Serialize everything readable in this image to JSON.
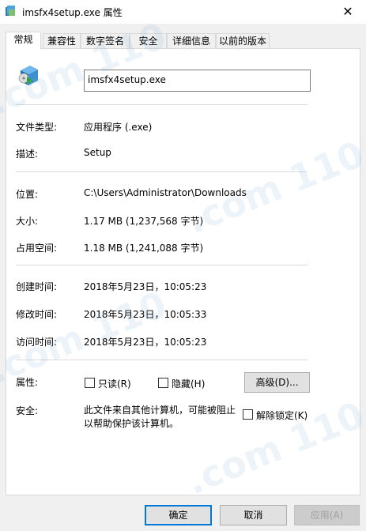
{
  "window": {
    "title": "imsfx4setup.exe 属性",
    "close_glyph": "✕",
    "title_icon": "executable-icon"
  },
  "tabs": [
    {
      "label": "常规",
      "active": true
    },
    {
      "label": "兼容性",
      "active": false
    },
    {
      "label": "数字签名",
      "active": false
    },
    {
      "label": "安全",
      "active": false
    },
    {
      "label": "详细信息",
      "active": false
    },
    {
      "label": "以前的版本",
      "active": false
    }
  ],
  "general": {
    "file_name": "imsfx4setup.exe",
    "file_icon": "installer-box-icon",
    "file_type_label": "文件类型:",
    "file_type_value": "应用程序 (.exe)",
    "description_label": "描述:",
    "description_value": "Setup",
    "location_label": "位置:",
    "location_value": "C:\\Users\\Administrator\\Downloads",
    "size_label": "大小:",
    "size_value": "1.17 MB (1,237,568 字节)",
    "size_on_disk_label": "占用空间:",
    "size_on_disk_value": "1.18 MB (1,241,088 字节)",
    "created_label": "创建时间:",
    "created_value": "2018年5月23日，10:05:23",
    "modified_label": "修改时间:",
    "modified_value": "2018年5月23日，10:05:33",
    "accessed_label": "访问时间:",
    "accessed_value": "2018年5月23日，10:05:23",
    "attributes_label": "属性:",
    "readonly_label": "只读(R)",
    "readonly_checked": false,
    "hidden_label": "隐藏(H)",
    "hidden_checked": false,
    "advanced_button": "高级(D)...",
    "security_label": "安全:",
    "security_text": "此文件来自其他计算机，可能被阻止以帮助保护该计算机。",
    "unblock_label": "解除锁定(K)",
    "unblock_checked": false
  },
  "footer": {
    "ok": "确定",
    "cancel": "取消",
    "apply": "应用(A)",
    "apply_enabled": false
  },
  "watermark": ".com 110"
}
